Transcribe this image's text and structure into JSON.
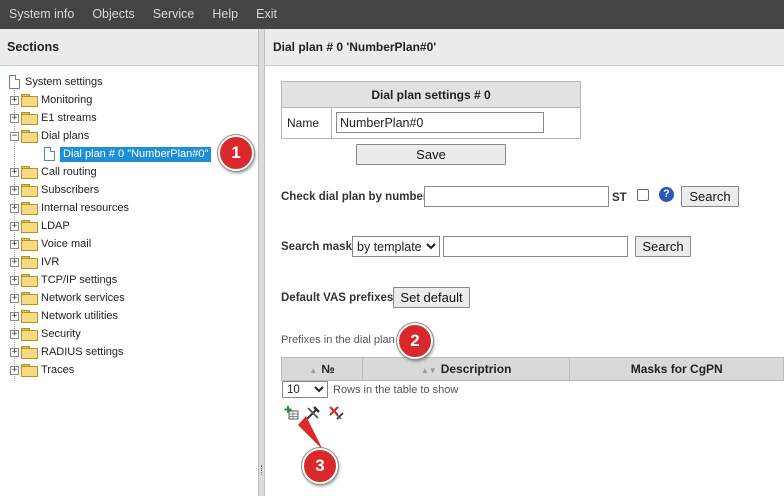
{
  "menu": [
    "System info",
    "Objects",
    "Service",
    "Help",
    "Exit"
  ],
  "left": {
    "title": "Sections",
    "tree": [
      {
        "label": "System settings",
        "type": "doc",
        "level": 0
      },
      {
        "label": "Monitoring",
        "type": "folder",
        "toggle": "+"
      },
      {
        "label": "E1 streams",
        "type": "folder",
        "toggle": "+"
      },
      {
        "label": "Dial plans",
        "type": "folder",
        "toggle": "−"
      },
      {
        "label": "Dial plan # 0 \"NumberPlan#0\"",
        "type": "doc",
        "selected": true
      },
      {
        "label": "Call routing",
        "type": "folder",
        "toggle": "+"
      },
      {
        "label": "Subscribers",
        "type": "folder",
        "toggle": "+"
      },
      {
        "label": "Internal resources",
        "type": "folder",
        "toggle": "+"
      },
      {
        "label": "LDAP",
        "type": "folder",
        "toggle": "+"
      },
      {
        "label": "Voice mail",
        "type": "folder",
        "toggle": "+"
      },
      {
        "label": "IVR",
        "type": "folder",
        "toggle": "+"
      },
      {
        "label": "TCP/IP settings",
        "type": "folder",
        "toggle": "+"
      },
      {
        "label": "Network services",
        "type": "folder",
        "toggle": "+"
      },
      {
        "label": "Network utilities",
        "type": "folder",
        "toggle": "+"
      },
      {
        "label": "Security",
        "type": "folder",
        "toggle": "+"
      },
      {
        "label": "RADIUS settings",
        "type": "folder",
        "toggle": "+"
      },
      {
        "label": "Traces",
        "type": "folder",
        "toggle": "+"
      }
    ]
  },
  "right": {
    "title": "Dial plan # 0 'NumberPlan#0'",
    "settings": {
      "header": "Dial plan settings # 0",
      "name_label": "Name",
      "name_value": "NumberPlan#0",
      "save_label": "Save"
    },
    "check": {
      "label": "Check dial plan by number",
      "value": "",
      "st_label": "ST",
      "help": "?",
      "search_label": "Search"
    },
    "mask": {
      "label": "Search mask",
      "select_value": "by template",
      "value": "",
      "search_label": "Search"
    },
    "vas": {
      "label": "Default VAS prefixes",
      "button": "Set default"
    },
    "prefixes_caption": "Prefixes in the dial plan",
    "columns": [
      "№",
      "Descriptrion",
      "Masks for CgPN"
    ],
    "rows_select": "10",
    "rows_label": "Rows in the table to show"
  },
  "icons": [
    "add-row-icon",
    "edit-tools-icon",
    "delete-icon"
  ],
  "annotations": [
    "1",
    "2",
    "3"
  ],
  "colors": {
    "menubar": "#444444",
    "selection": "#1e8fd6",
    "badge": "#d9292b"
  }
}
